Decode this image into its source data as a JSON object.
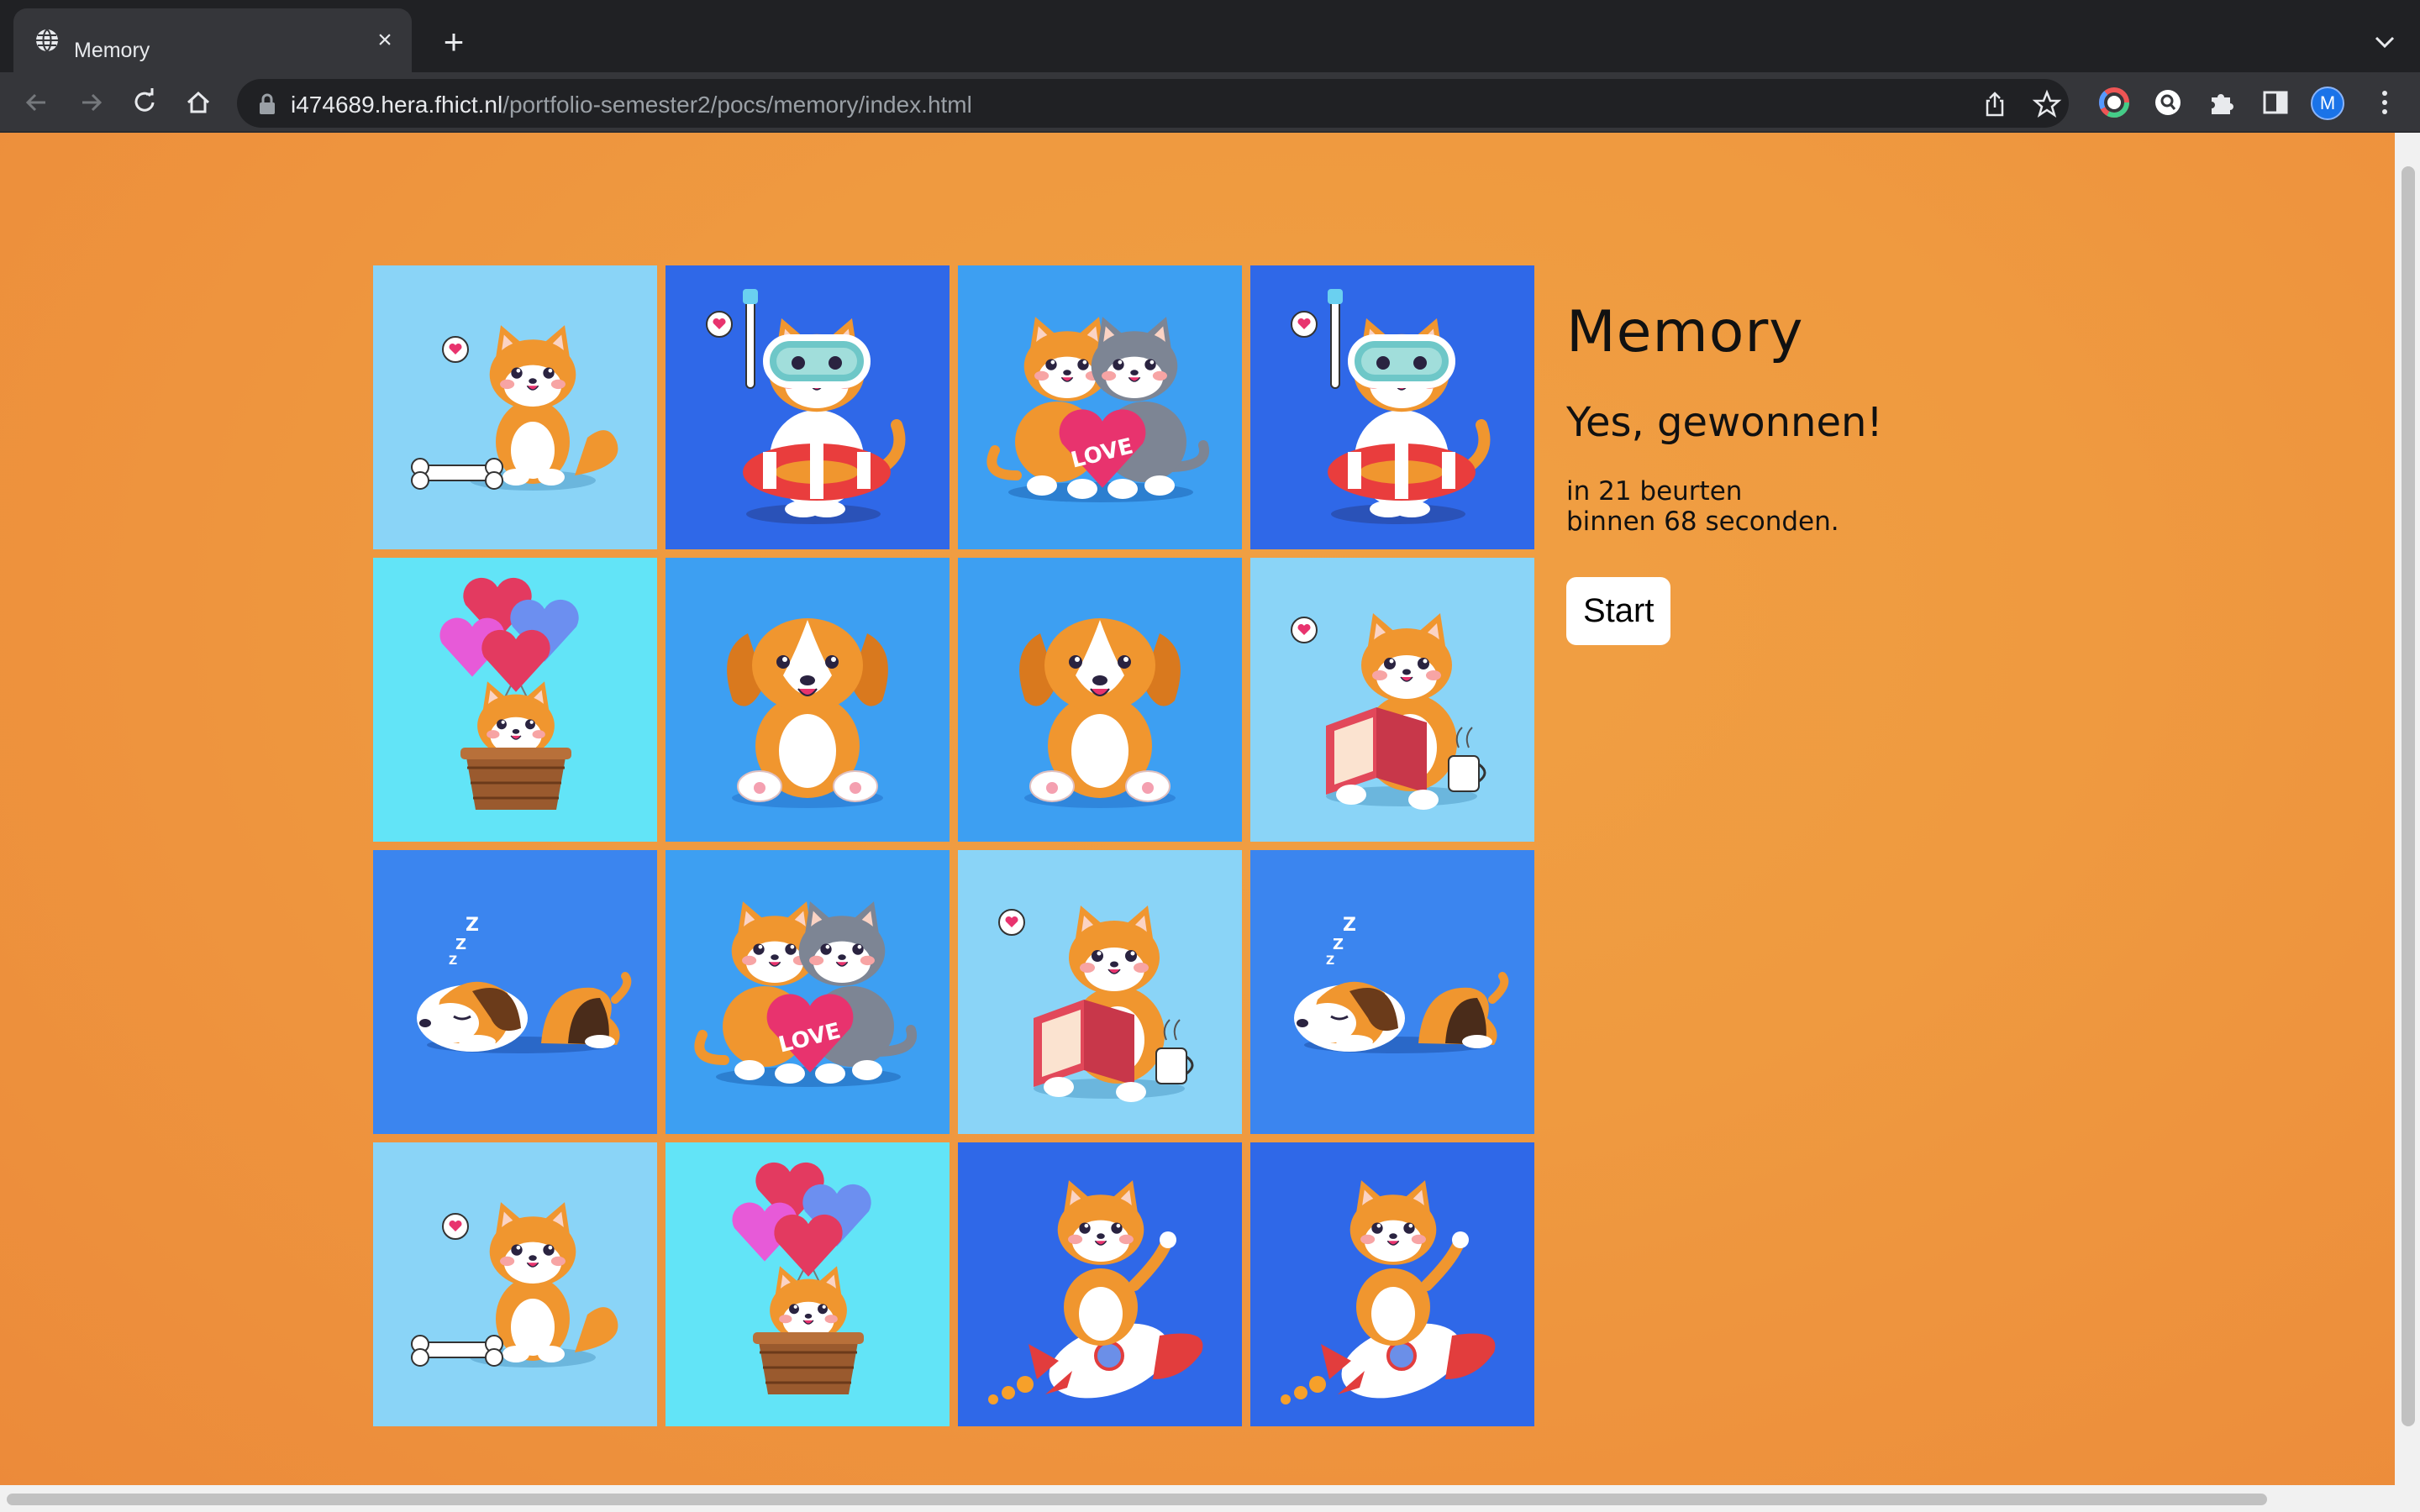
{
  "browser": {
    "tab_title": "Memory",
    "new_tab": "+",
    "url_host": "i474689.hera.fhict.nl",
    "url_path": "/portfolio-semester2/pocs/memory/index.html",
    "profile_initial": "M"
  },
  "game": {
    "title": "Memory",
    "result": "Yes, gewonnen!",
    "turns_text": "in 21 beurten",
    "time_text": "binnen 68 seconden.",
    "start_label": "Start"
  },
  "cards": [
    {
      "motif": "shiba-bone",
      "bg": "#8ad4f7"
    },
    {
      "motif": "snorkel-cat",
      "bg": "#2f68e8"
    },
    {
      "motif": "cats-love",
      "bg": "#3d9ff2"
    },
    {
      "motif": "snorkel-cat",
      "bg": "#2f68e8"
    },
    {
      "motif": "balloon-corgi",
      "bg": "#62e4f7"
    },
    {
      "motif": "puppy",
      "bg": "#3d9ff2"
    },
    {
      "motif": "puppy",
      "bg": "#3d9ff2"
    },
    {
      "motif": "shiba-reading",
      "bg": "#8ad4f7"
    },
    {
      "motif": "sleeping-dog",
      "bg": "#3b85ef"
    },
    {
      "motif": "cats-love",
      "bg": "#3d9ff2"
    },
    {
      "motif": "shiba-reading",
      "bg": "#8ad4f7"
    },
    {
      "motif": "sleeping-dog",
      "bg": "#3b85ef"
    },
    {
      "motif": "shiba-bone",
      "bg": "#8ad4f7"
    },
    {
      "motif": "balloon-corgi",
      "bg": "#62e4f7"
    },
    {
      "motif": "rocket-shiba",
      "bg": "#2f68e8"
    },
    {
      "motif": "rocket-shiba",
      "bg": "#2f68e8"
    }
  ],
  "card_text": {
    "love": "LOVE",
    "zzz": "Z"
  }
}
